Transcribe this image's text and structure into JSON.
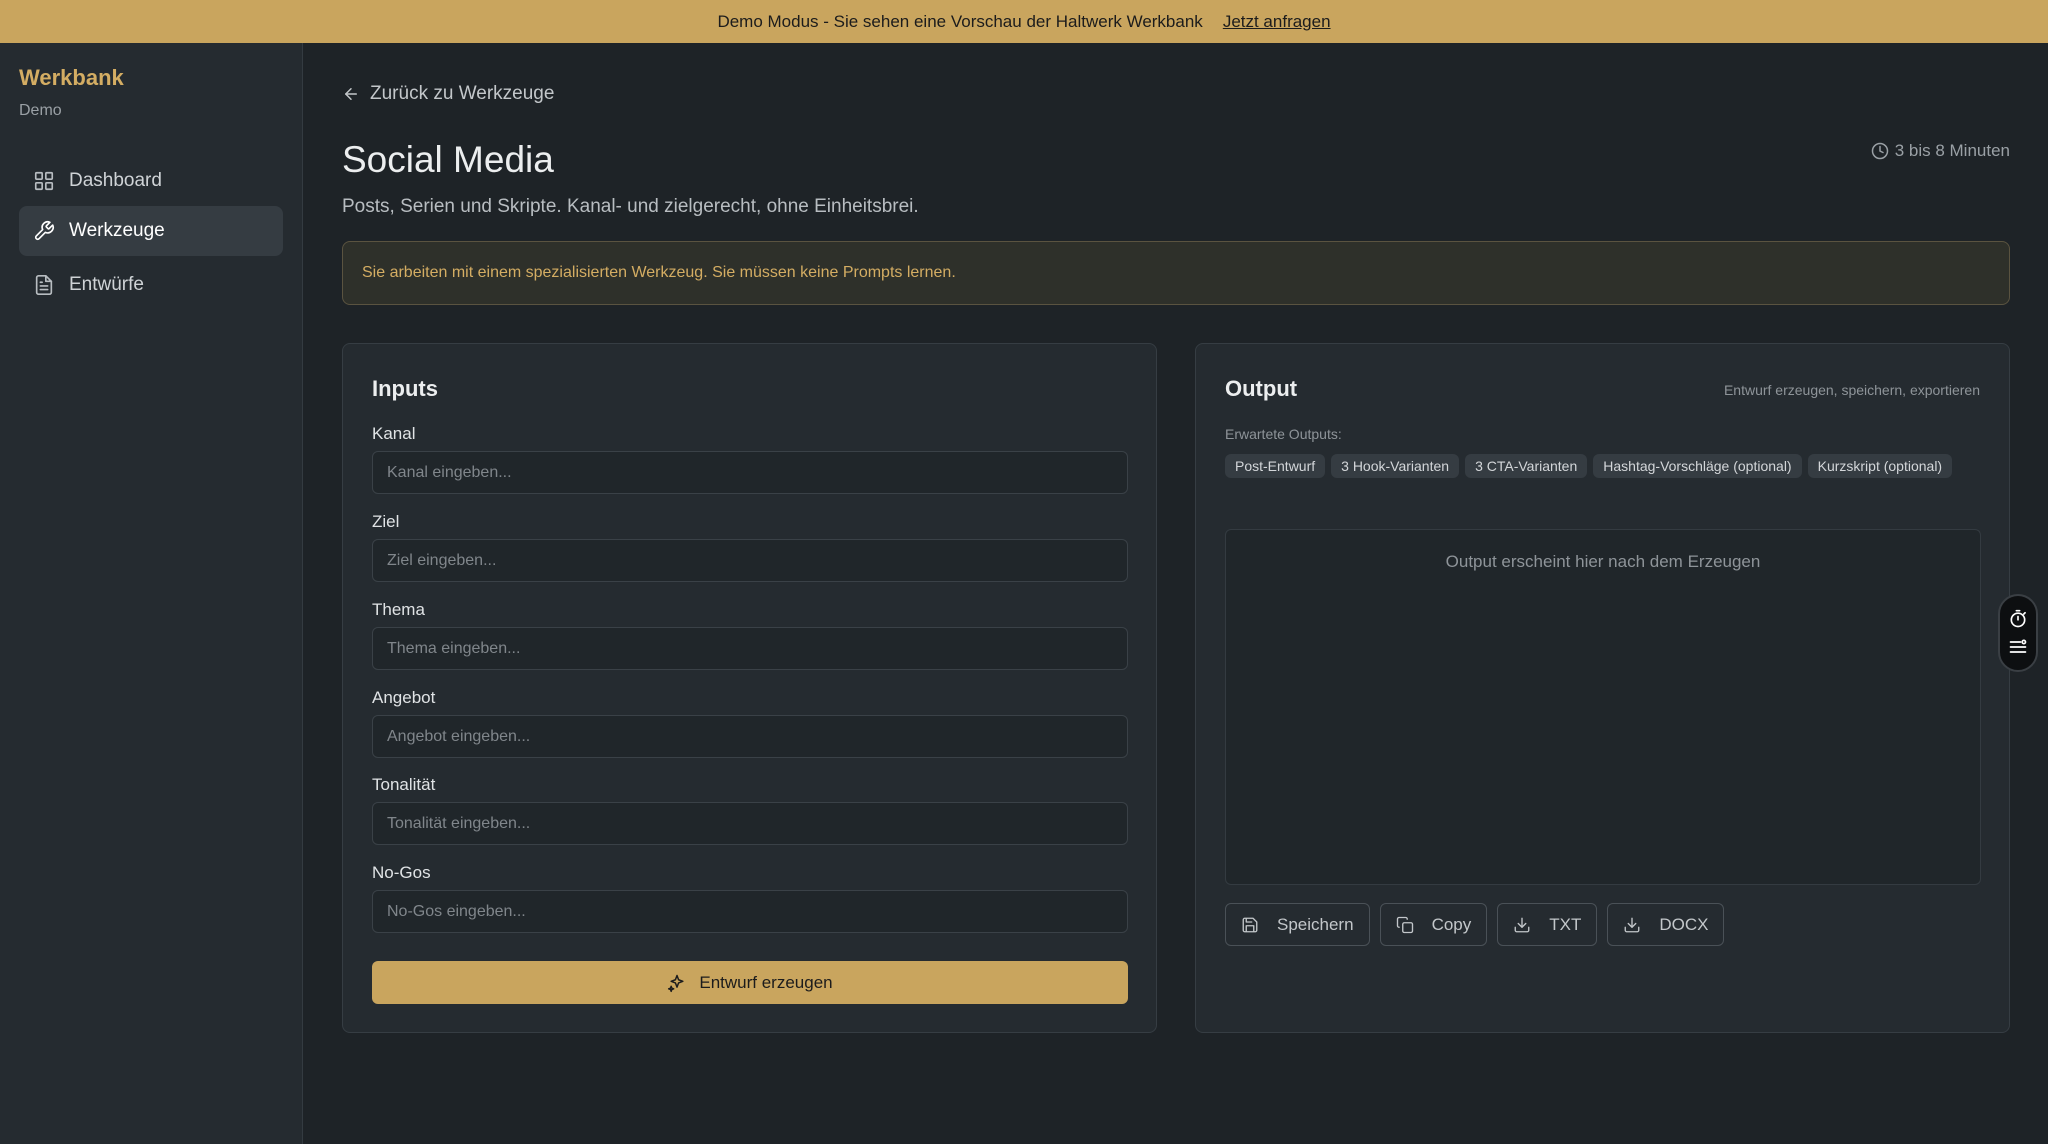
{
  "banner": {
    "text": "Demo Modus - Sie sehen eine Vorschau der Haltwerk Werkbank",
    "link": "Jetzt anfragen"
  },
  "sidebar": {
    "brand": "Werkbank",
    "subtitle": "Demo",
    "items": [
      {
        "label": "Dashboard",
        "icon": "grid-icon",
        "active": false
      },
      {
        "label": "Werkzeuge",
        "icon": "wrench-icon",
        "active": true
      },
      {
        "label": "Entwürfe",
        "icon": "document-icon",
        "active": false
      }
    ]
  },
  "main": {
    "back_label": "Zurück zu Werkzeuge",
    "title": "Social Media",
    "duration": "3 bis 8 Minuten",
    "subtitle": "Posts, Serien und Skripte. Kanal- und zielgerecht, ohne Einheitsbrei.",
    "notice": "Sie arbeiten mit einem spezialisierten Werkzeug. Sie müssen keine Prompts lernen."
  },
  "inputs": {
    "title": "Inputs",
    "fields": [
      {
        "label": "Kanal",
        "placeholder": "Kanal eingeben...",
        "value": ""
      },
      {
        "label": "Ziel",
        "placeholder": "Ziel eingeben...",
        "value": ""
      },
      {
        "label": "Thema",
        "placeholder": "Thema eingeben...",
        "value": ""
      },
      {
        "label": "Angebot",
        "placeholder": "Angebot eingeben...",
        "value": ""
      },
      {
        "label": "Tonalität",
        "placeholder": "Tonalität eingeben...",
        "value": ""
      },
      {
        "label": "No-Gos",
        "placeholder": "No-Gos eingeben...",
        "value": ""
      }
    ],
    "generate_label": "Entwurf erzeugen"
  },
  "output": {
    "title": "Output",
    "hint": "Entwurf erzeugen, speichern, exportieren",
    "expected_label": "Erwartete Outputs:",
    "chips": [
      "Post-Entwurf",
      "3 Hook-Varianten",
      "3 CTA-Varianten",
      "Hashtag-Vorschläge (optional)",
      "Kurzskript (optional)"
    ],
    "placeholder": "Output erscheint hier nach dem Erzeugen",
    "actions": [
      {
        "label": "Speichern",
        "icon": "save-icon"
      },
      {
        "label": "Copy",
        "icon": "copy-icon"
      },
      {
        "label": "TXT",
        "icon": "download-icon"
      },
      {
        "label": "DOCX",
        "icon": "download-icon"
      }
    ]
  },
  "colors": {
    "accent": "#c9a55e",
    "background": "#1e2327",
    "panel": "#252b30"
  }
}
